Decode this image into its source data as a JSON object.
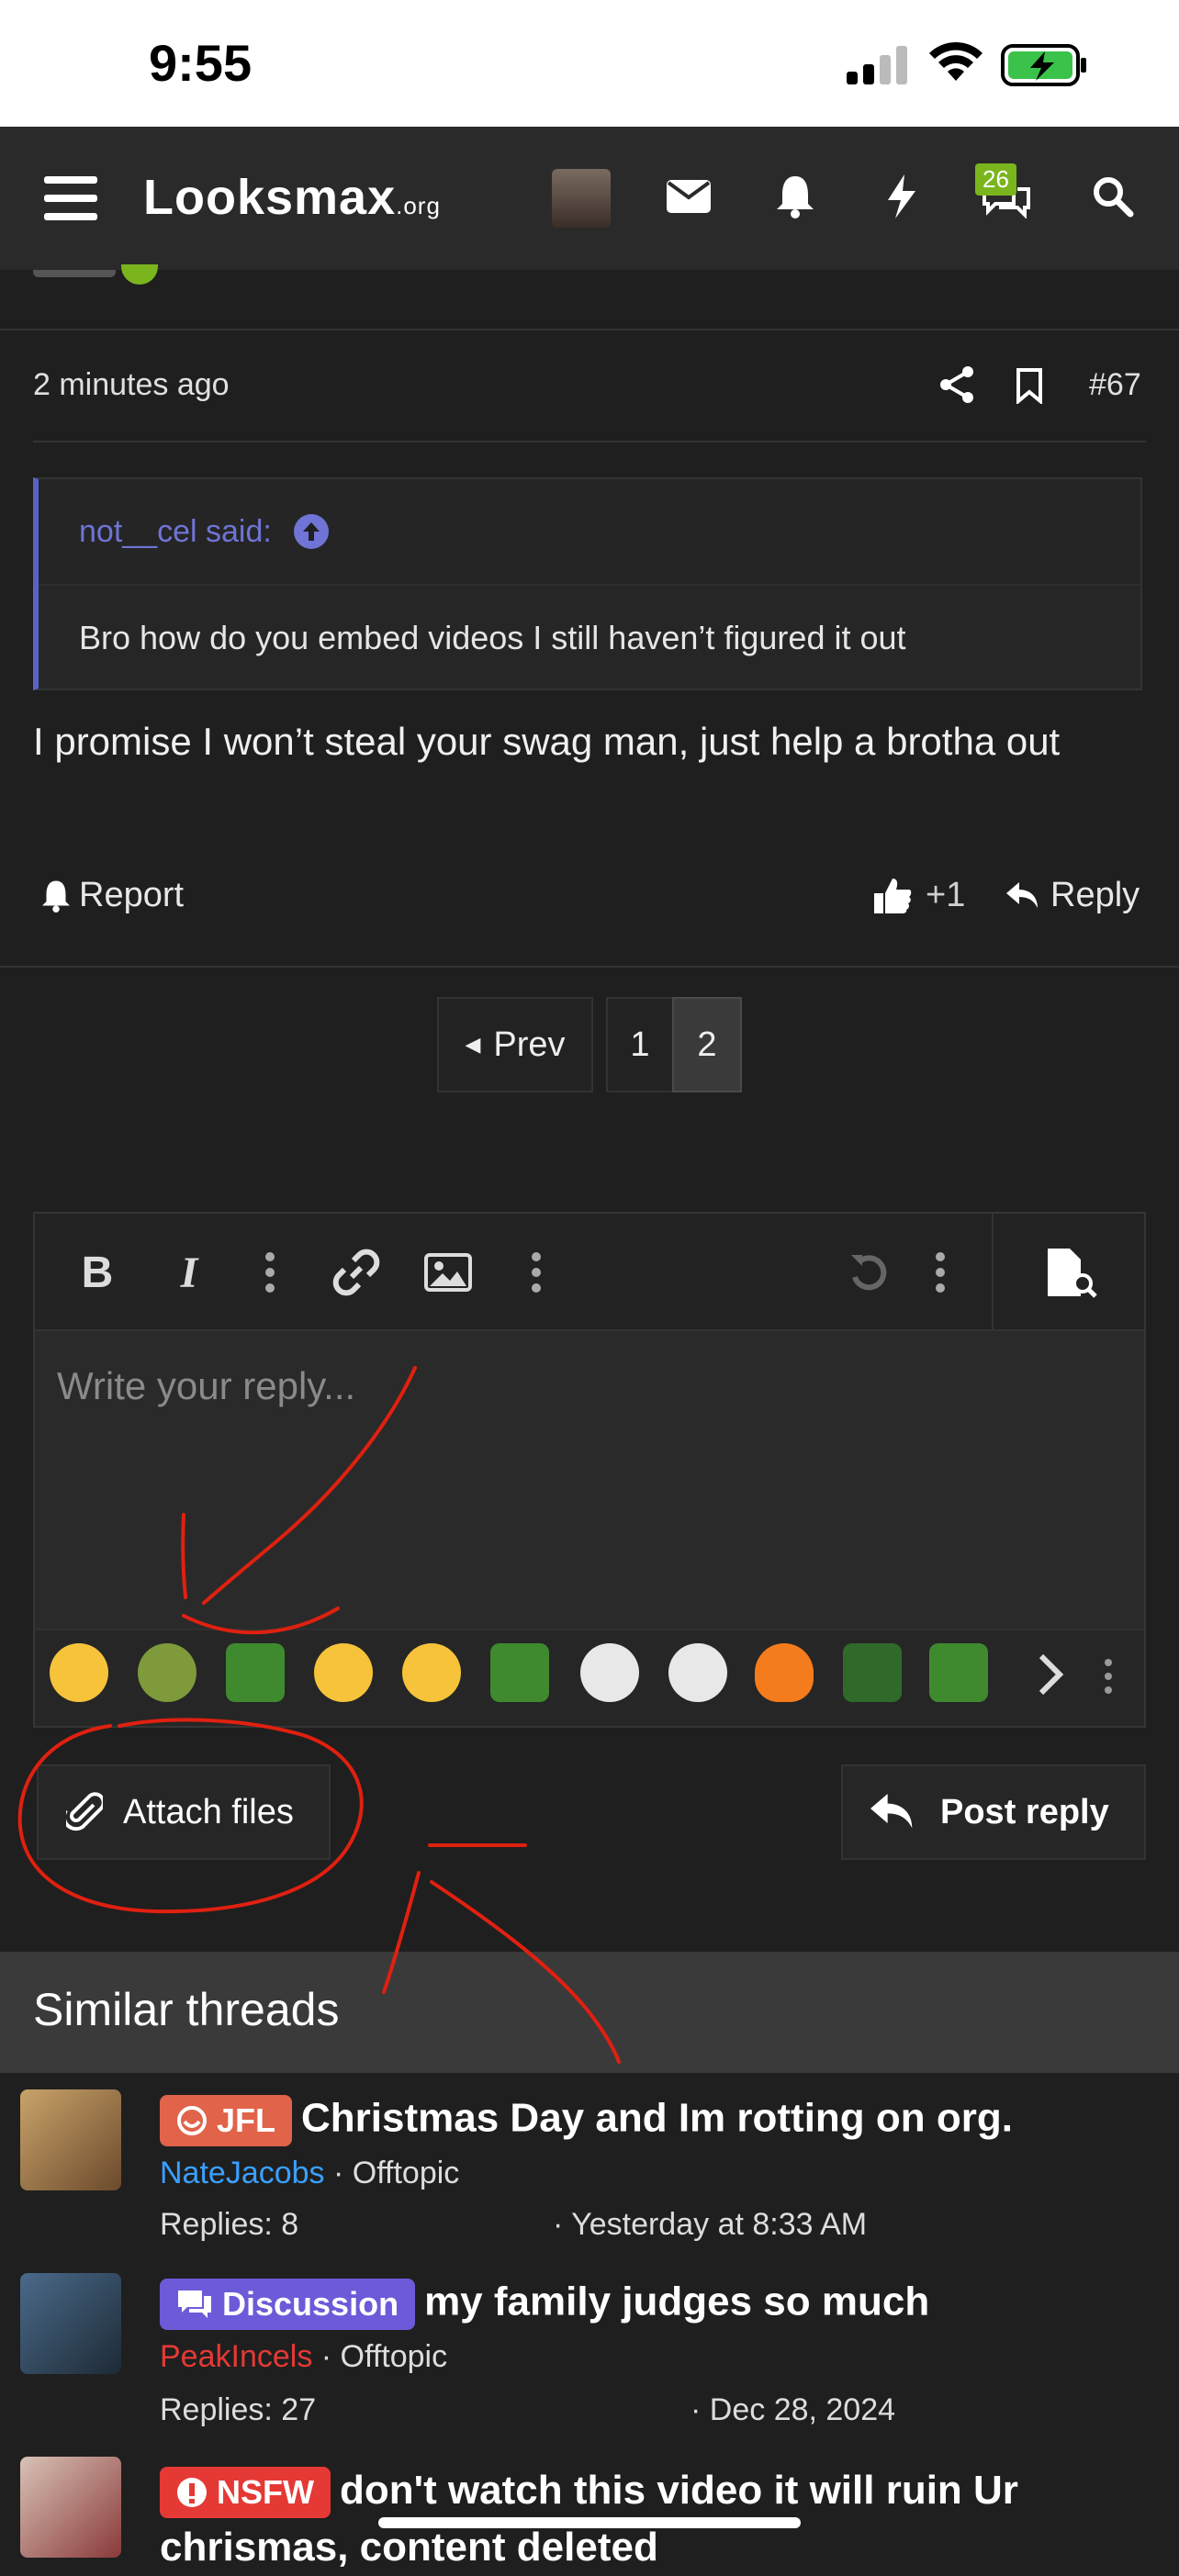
{
  "status_bar": {
    "time": "9:55"
  },
  "header": {
    "logo_main": "Looksmax",
    "logo_suffix": ".org",
    "notification_badge": "26"
  },
  "post": {
    "time": "2 minutes ago",
    "number": "#67",
    "quote_author": "not__cel said:",
    "quote_text": "Bro how do you embed videos I still haven’t figured it out",
    "body": "I promise I won’t steal your swag man, just help a brotha out",
    "report_label": "Report",
    "like_count": "+1",
    "reply_label": "Reply"
  },
  "pagination": {
    "prev_label": "Prev",
    "pages": [
      "1",
      "2"
    ],
    "current_page": "2"
  },
  "editor": {
    "placeholder": "Write your reply...",
    "attach_label": "Attach files",
    "post_label": "Post reply"
  },
  "similar": {
    "heading": "Similar threads",
    "threads": [
      {
        "tag": "JFL",
        "tag_color": "#e0634a",
        "title": "Christmas Day and Im rotting on org.",
        "author": "NateJacobs",
        "author_color": "#3aa0ff",
        "forum": "Offtopic",
        "replies": "Replies: 8",
        "date": "Yesterday at 8:33 AM"
      },
      {
        "tag": "Discussion",
        "tag_color": "#6b5bd8",
        "title": "my family judges so much",
        "author": "PeakIncels",
        "author_color": "#e53935",
        "forum": "Offtopic",
        "replies": "Replies: 27",
        "date": "Dec 28, 2024"
      },
      {
        "tag": "NSFW",
        "tag_color": "#e53935",
        "title": "don't watch this video it will ruin Ur chrismas, content deleted"
      }
    ]
  },
  "colors": {
    "accent_quote": "#5a62c9",
    "annotation_red": "#e02010"
  }
}
